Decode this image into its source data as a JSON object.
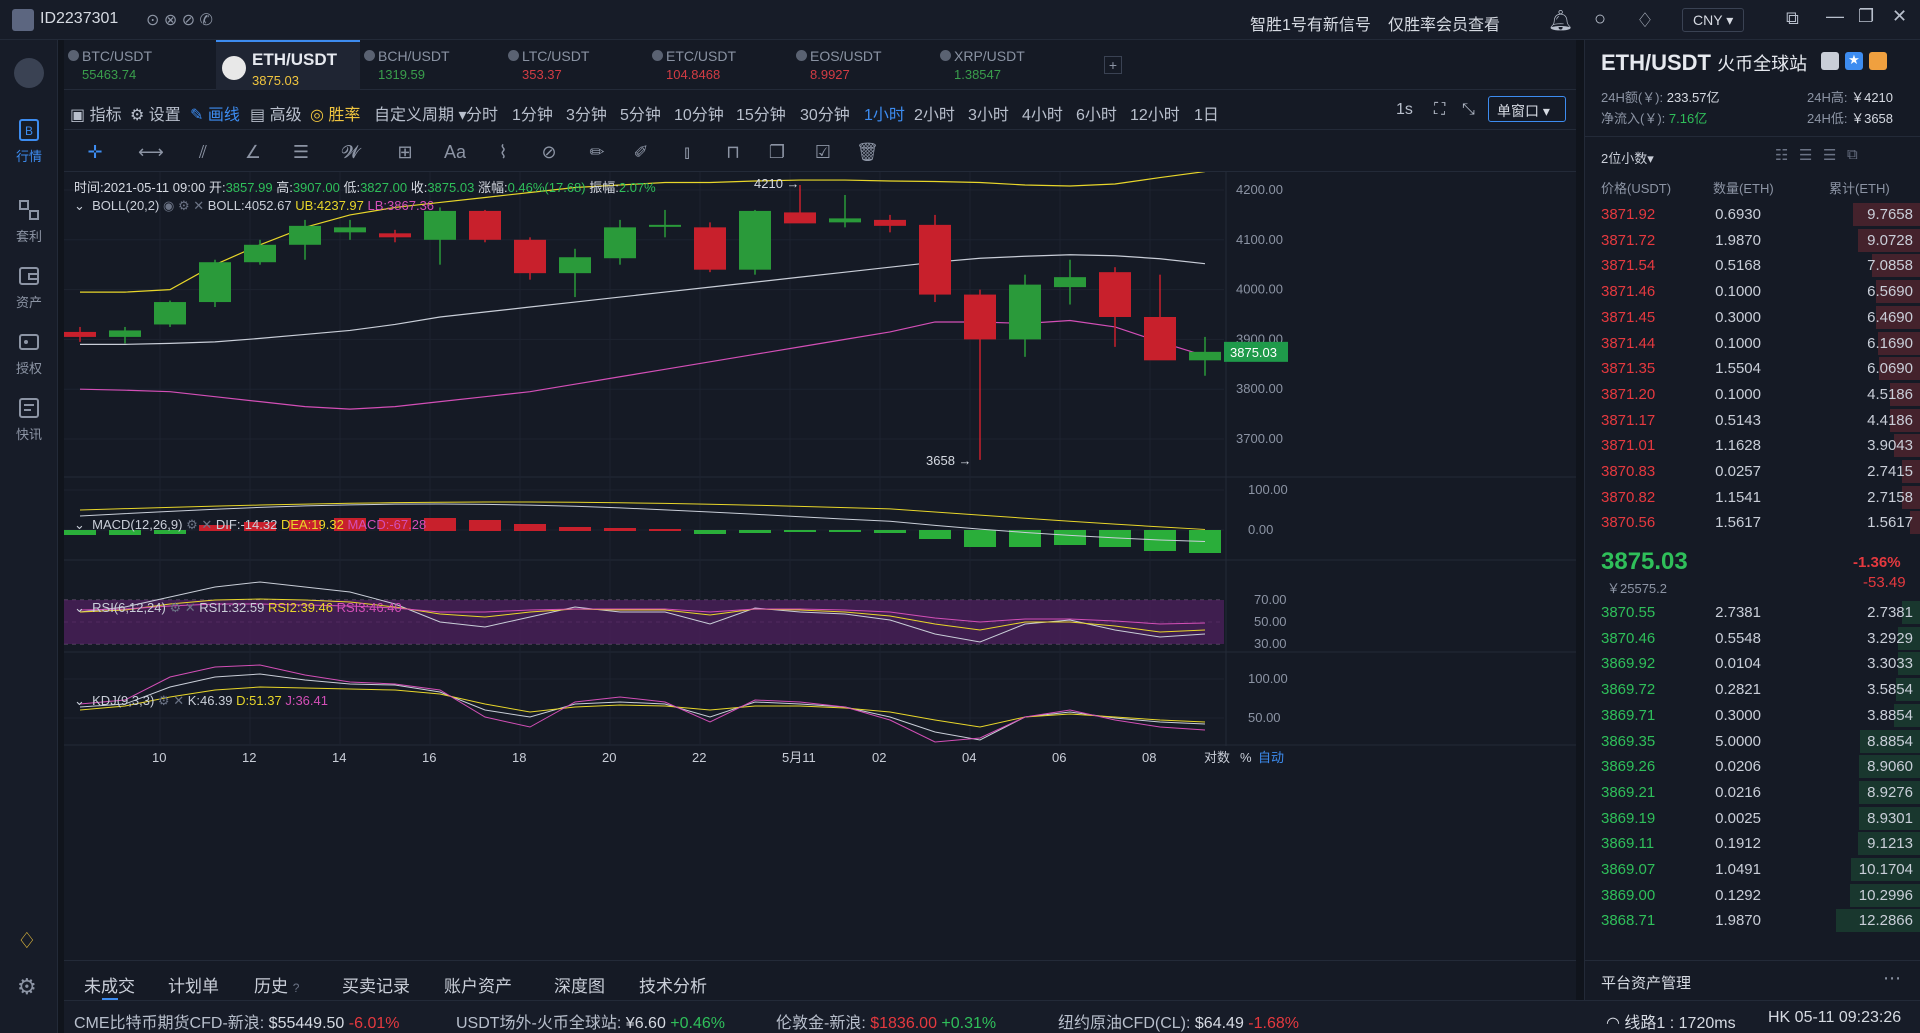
{
  "window": {
    "user_id": "ID2237301",
    "notice": "智胜1号有新信号",
    "notice_link": "仅胜率会员查看",
    "currency": "CNY"
  },
  "sidebar": {
    "items": [
      {
        "label": "行情",
        "active": true
      },
      {
        "label": "套利"
      },
      {
        "label": "资产"
      },
      {
        "label": "授权"
      },
      {
        "label": "快讯"
      }
    ]
  },
  "tabs": [
    {
      "name": "BTC/USDT",
      "price": "55463.74",
      "dir": "up"
    },
    {
      "name": "ETH/USDT",
      "price": "3875.03",
      "active": true
    },
    {
      "name": "BCH/USDT",
      "price": "1319.59",
      "dir": "up"
    },
    {
      "name": "LTC/USDT",
      "price": "353.37",
      "dir": "down"
    },
    {
      "name": "ETC/USDT",
      "price": "104.8468",
      "dir": "down"
    },
    {
      "name": "EOS/USDT",
      "price": "8.9927",
      "dir": "down"
    },
    {
      "name": "XRP/USDT",
      "price": "1.38547",
      "dir": "up"
    }
  ],
  "toolbar": {
    "indicator": "指标",
    "settings": "设置",
    "draw": "画线",
    "advanced": "高级",
    "winrate": "胜率",
    "custom_period": "自定义周期",
    "periods": [
      "分时",
      "1分钟",
      "3分钟",
      "5分钟",
      "10分钟",
      "15分钟",
      "30分钟",
      "1小时",
      "2小时",
      "3小时",
      "4小时",
      "6小时",
      "12小时",
      "1日"
    ],
    "active_period": "1小时",
    "interval": "1s",
    "window_mode": "单窗口"
  },
  "ohlc_bar": {
    "time_label": "时间:",
    "time": "2021-05-11 09:00",
    "open_label": "开:",
    "open": "3857.99",
    "high_label": "高:",
    "high": "3907.00",
    "low_label": "低:",
    "low": "3827.00",
    "close_label": "收:",
    "close": "3875.03",
    "chg_label": "涨幅:",
    "chg": "0.46%(17.68)",
    "amp_label": "振幅:",
    "amp": "2.07%"
  },
  "indicators": {
    "boll": {
      "name": "BOLL(20,2)",
      "mid": "BOLL:4052.67",
      "ub": "UB:4237.97",
      "lb": "LB:3867.36"
    },
    "macd": {
      "name": "MACD(12,26,9)",
      "dif": "DIF:-14.32",
      "dea": "DEA:19.32",
      "macd": "MACD:-67.28"
    },
    "rsi": {
      "name": "RSI(6,12,24)",
      "rsi1": "RSI1:32.59",
      "rsi2": "RSI2:39.46",
      "rsi3": "RSI3:46.40"
    },
    "kdj": {
      "name": "KDJ(9,3,3)",
      "k": "K:46.39",
      "d": "D:51.37",
      "j": "J:36.41"
    }
  },
  "chart_data": {
    "type": "candlestick",
    "x_ticks": [
      "10",
      "12",
      "14",
      "16",
      "18",
      "20",
      "22",
      "5月11",
      "02",
      "04",
      "06",
      "08"
    ],
    "price_ticks": [
      "4200.00",
      "4100.00",
      "4000.00",
      "3900.00",
      "3800.00",
      "3700.00"
    ],
    "last_price": "3875.03",
    "max_label": "4210 →",
    "min_label": "3658 →",
    "candles": [
      {
        "o": 3915,
        "h": 3925,
        "l": 3895,
        "c": 3905
      },
      {
        "o": 3905,
        "h": 3925,
        "l": 3892,
        "c": 3918
      },
      {
        "o": 3930,
        "h": 3978,
        "l": 3925,
        "c": 3975
      },
      {
        "o": 3975,
        "h": 4060,
        "l": 3965,
        "c": 4055
      },
      {
        "o": 4055,
        "h": 4100,
        "l": 4050,
        "c": 4090
      },
      {
        "o": 4090,
        "h": 4140,
        "l": 4060,
        "c": 4128
      },
      {
        "o": 4115,
        "h": 4140,
        "l": 4100,
        "c": 4125
      },
      {
        "o": 4113,
        "h": 4120,
        "l": 4095,
        "c": 4105
      },
      {
        "o": 4100,
        "h": 4165,
        "l": 4050,
        "c": 4158
      },
      {
        "o": 4158,
        "h": 4160,
        "l": 4095,
        "c": 4100
      },
      {
        "o": 4100,
        "h": 4105,
        "l": 4020,
        "c": 4033
      },
      {
        "o": 4033,
        "h": 4082,
        "l": 3985,
        "c": 4065
      },
      {
        "o": 4063,
        "h": 4140,
        "l": 4050,
        "c": 4125
      },
      {
        "o": 4130,
        "h": 4160,
        "l": 4105,
        "c": 4130
      },
      {
        "o": 4125,
        "h": 4135,
        "l": 4035,
        "c": 4040
      },
      {
        "o": 4040,
        "h": 4160,
        "l": 4030,
        "c": 4158
      },
      {
        "o": 4155,
        "h": 4210,
        "l": 4140,
        "c": 4133
      },
      {
        "o": 4135,
        "h": 4190,
        "l": 4125,
        "c": 4143
      },
      {
        "o": 4140,
        "h": 4150,
        "l": 4115,
        "c": 4128
      },
      {
        "o": 4130,
        "h": 4150,
        "l": 3975,
        "c": 3990
      },
      {
        "o": 3990,
        "h": 4000,
        "l": 3658,
        "c": 3900
      },
      {
        "o": 3900,
        "h": 4030,
        "l": 3865,
        "c": 4010
      },
      {
        "o": 4005,
        "h": 4060,
        "l": 3970,
        "c": 4025
      },
      {
        "o": 4035,
        "h": 4045,
        "l": 3885,
        "c": 3945
      },
      {
        "o": 3945,
        "h": 4030,
        "l": 3860,
        "c": 3858
      },
      {
        "o": 3858,
        "h": 3905,
        "l": 3827,
        "c": 3875
      }
    ],
    "macd_ticks": [
      "100.00",
      "0.00"
    ],
    "rsi_ticks": [
      "70.00",
      "50.00",
      "30.00"
    ],
    "kdj_ticks": [
      "100.00",
      "50.00"
    ],
    "scale_labels": {
      "log": "对数",
      "pct": "%",
      "auto": "自动"
    }
  },
  "right": {
    "pair": "ETH/USDT",
    "exchange": "火币全球站",
    "vol24_label": "24H额(￥):",
    "vol24": "233.57亿",
    "high24_label": "24H高:",
    "high24": "￥4210",
    "inflow_label": "净流入(￥):",
    "inflow": "7.16亿",
    "low24_label": "24H低:",
    "low24": "￥3658",
    "decimals": "2位小数",
    "col_price": "价格(USDT)",
    "col_qty": "数量(ETH)",
    "col_cum": "累计(ETH)",
    "asks": [
      [
        "3871.92",
        "0.6930",
        "9.7658"
      ],
      [
        "3871.72",
        "1.9870",
        "9.0728"
      ],
      [
        "3871.54",
        "0.5168",
        "7.0858"
      ],
      [
        "3871.46",
        "0.1000",
        "6.5690"
      ],
      [
        "3871.45",
        "0.3000",
        "6.4690"
      ],
      [
        "3871.44",
        "0.1000",
        "6.1690"
      ],
      [
        "3871.35",
        "1.5504",
        "6.0690"
      ],
      [
        "3871.20",
        "0.1000",
        "4.5186"
      ],
      [
        "3871.17",
        "0.5143",
        "4.4186"
      ],
      [
        "3871.01",
        "1.1628",
        "3.9043"
      ],
      [
        "3870.83",
        "0.0257",
        "2.7415"
      ],
      [
        "3870.82",
        "1.1541",
        "2.7158"
      ],
      [
        "3870.56",
        "1.5617",
        "1.5617"
      ]
    ],
    "last": "3875.03",
    "last_cny": "￥25575.2",
    "chg_pct": "-1.36%",
    "chg_abs": "-53.49",
    "bids": [
      [
        "3870.55",
        "2.7381",
        "2.7381"
      ],
      [
        "3870.46",
        "0.5548",
        "3.2929"
      ],
      [
        "3869.92",
        "0.0104",
        "3.3033"
      ],
      [
        "3869.72",
        "0.2821",
        "3.5854"
      ],
      [
        "3869.71",
        "0.3000",
        "3.8854"
      ],
      [
        "3869.35",
        "5.0000",
        "8.8854"
      ],
      [
        "3869.26",
        "0.0206",
        "8.9060"
      ],
      [
        "3869.21",
        "0.0216",
        "8.9276"
      ],
      [
        "3869.19",
        "0.0025",
        "8.9301"
      ],
      [
        "3869.11",
        "0.1912",
        "9.1213"
      ],
      [
        "3869.07",
        "1.0491",
        "10.1704"
      ],
      [
        "3869.00",
        "0.1292",
        "10.2996"
      ],
      [
        "3868.71",
        "1.9870",
        "12.2866"
      ]
    ],
    "footer": "平台资产管理"
  },
  "bottom_tabs": [
    "未成交",
    "计划单",
    "历史",
    "买卖记录",
    "账户资产",
    "深度图",
    "技术分析"
  ],
  "ticker": [
    {
      "name": "CME比特币期货CFD-新浪:",
      "price": "$55449.50",
      "chg": "-6.01%",
      "dir": "down"
    },
    {
      "name": "USDT场外-火币全球站:",
      "price": "¥6.60",
      "chg": "+0.46%",
      "dir": "up"
    },
    {
      "name": "伦敦金-新浪:",
      "price": "$1836.00",
      "chg": "+0.31%",
      "dir": "up"
    },
    {
      "name": "纽约原油CFD(CL):",
      "price": "$64.49",
      "chg": "-1.68%",
      "dir": "down"
    }
  ],
  "status": {
    "line": "线路1 : 1720ms",
    "clock": "HK 05-11 09:23:26"
  }
}
